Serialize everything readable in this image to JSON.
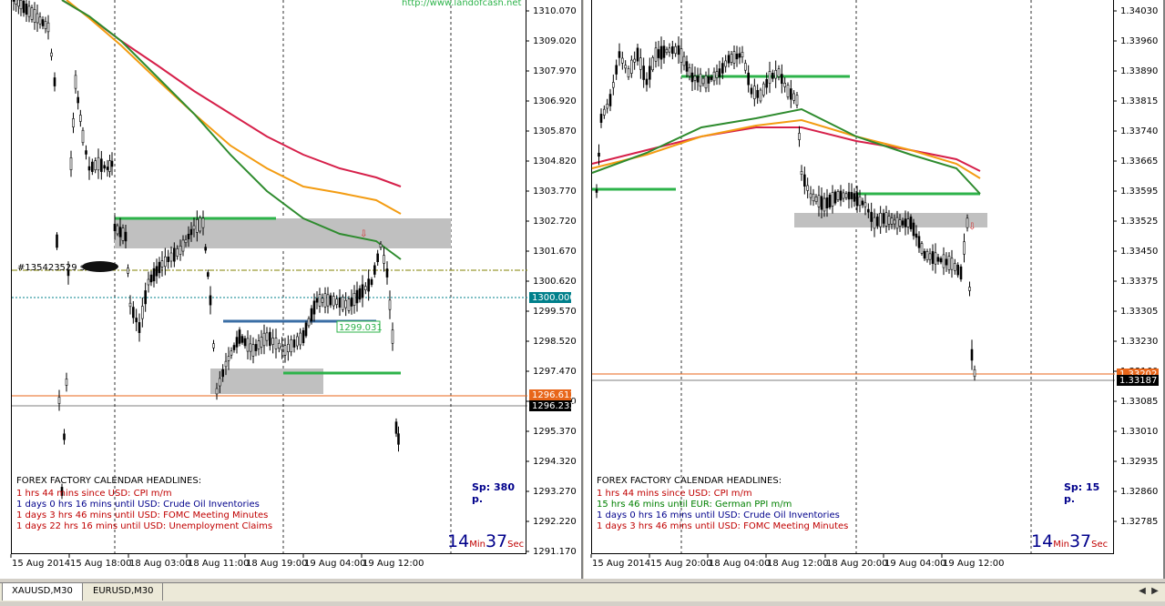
{
  "left": {
    "symbol": "XAUUSD,M30",
    "watermark": "http://www.landofcash.net",
    "price_axis": [
      "1310.070",
      "1309.020",
      "1307.970",
      "1306.920",
      "1305.870",
      "1304.820",
      "1303.770",
      "1302.720",
      "1301.670",
      "1300.620",
      "1299.570",
      "1298.520",
      "1297.470",
      "1296.420",
      "1295.370",
      "1294.320",
      "1293.270",
      "1292.220",
      "1291.170"
    ],
    "time_axis": [
      "15 Aug 2014",
      "15 Aug 18:00",
      "18 Aug 03:00",
      "18 Aug 11:00",
      "18 Aug 19:00",
      "19 Aug 04:00",
      "19 Aug 12:00"
    ],
    "price_labels": {
      "level": "1300.000",
      "bid": "1296.613",
      "ask": "1296.233"
    },
    "line_label": "1299.031",
    "object_label": "#135423529 sell",
    "news_title": "FOREX FACTORY CALENDAR HEADLINES:",
    "news": [
      {
        "text": "1 hrs 44 mins since USD: CPI m/m",
        "color": "#c00000"
      },
      {
        "text": "1 days 0 hrs 16 mins until USD: Crude Oil Inventories",
        "color": "#00008b"
      },
      {
        "text": "1 days 3 hrs 46 mins until USD: FOMC Meeting Minutes",
        "color": "#c00000"
      },
      {
        "text": "1 days 22 hrs 16 mins until USD: Unemployment Claims",
        "color": "#c00000"
      }
    ],
    "spread": "Sp: 380 p.",
    "timer": {
      "min": "14",
      "min_unit": "Min",
      "sec": "37",
      "sec_unit": "Sec"
    }
  },
  "right": {
    "symbol": "EURUSD,M30",
    "price_axis": [
      "1.34030",
      "1.33960",
      "1.33890",
      "1.33815",
      "1.33740",
      "1.33665",
      "1.33595",
      "1.33525",
      "1.33450",
      "1.33375",
      "1.33305",
      "1.33230",
      "1.33160",
      "1.33085",
      "1.33010",
      "1.32935",
      "1.32860",
      "1.32785"
    ],
    "time_axis": [
      "15 Aug 2014",
      "15 Aug 20:00",
      "18 Aug 04:00",
      "18 Aug 12:00",
      "18 Aug 20:00",
      "19 Aug 04:00",
      "19 Aug 12:00"
    ],
    "price_labels": {
      "bid": "1.33202",
      "ask": "1.33187"
    },
    "news_title": "FOREX FACTORY CALENDAR HEADLINES:",
    "news": [
      {
        "text": "1 hrs 44 mins since USD: CPI m/m",
        "color": "#c00000"
      },
      {
        "text": "15 hrs 46 mins until EUR: German PPI m/m",
        "color": "#008000"
      },
      {
        "text": "1 days 0 hrs 16 mins until USD: Crude Oil Inventories",
        "color": "#00008b"
      },
      {
        "text": "1 days 3 hrs 46 mins until USD: FOMC Meeting Minutes",
        "color": "#c00000"
      }
    ],
    "spread": "Sp: 15 p.",
    "timer": {
      "min": "14",
      "min_unit": "Min",
      "sec": "37",
      "sec_unit": "Sec"
    }
  },
  "tabs": [
    {
      "label": "XAUUSD,M30",
      "active": true
    },
    {
      "label": "EURUSD,M30",
      "active": false
    }
  ],
  "colors": {
    "ma_red": "#d6204a",
    "ma_orange": "#f39c12",
    "ma_green": "#2e8b2e",
    "zone": "#c0c0c0",
    "level_green": "#2db34a",
    "level_blue": "#3a6ea5",
    "bid_line": "#e8661a"
  }
}
